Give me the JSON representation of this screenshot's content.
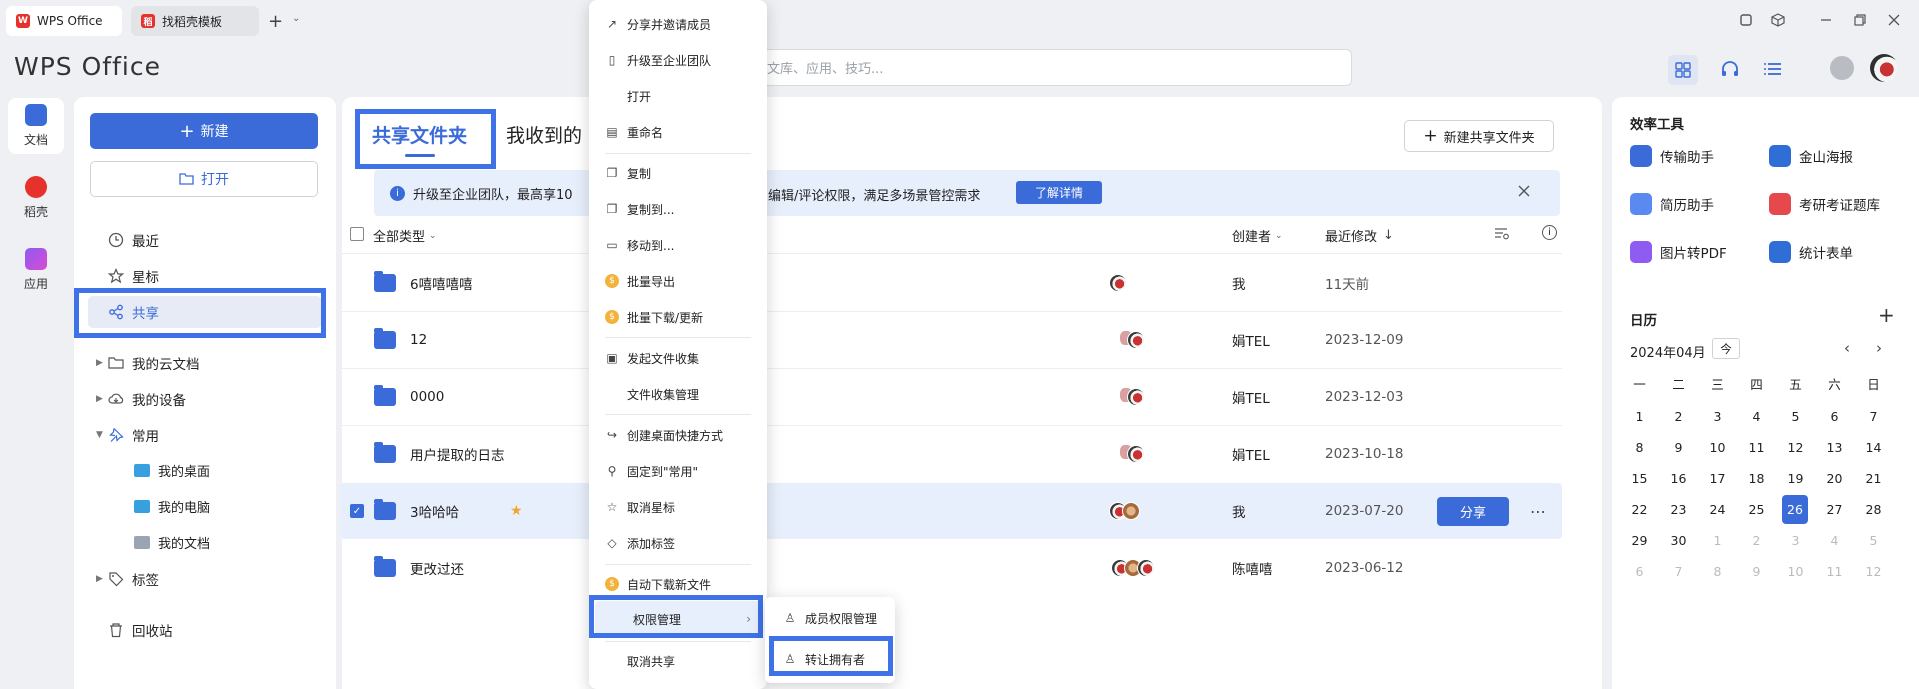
{
  "tabs": [
    {
      "label": "WPS Office",
      "icon": "wps-logo-icon"
    },
    {
      "label": "找稻壳模板",
      "icon": "docer-icon"
    }
  ],
  "app_logo": "WPS Office",
  "search": {
    "placeholder": "文库、应用、技巧..."
  },
  "rail": [
    {
      "label": "文档",
      "icon": "document-icon"
    },
    {
      "label": "稻壳",
      "icon": "docer-icon"
    },
    {
      "label": "应用",
      "icon": "apps-icon"
    }
  ],
  "nav": {
    "new_label": "新建",
    "open_label": "打开",
    "items": [
      "最近",
      "星标",
      "共享",
      "我的云文档",
      "我的设备",
      "常用",
      "标签",
      "回收站"
    ],
    "sub_items": [
      "我的桌面",
      "我的电脑",
      "我的文档"
    ]
  },
  "main": {
    "tab_shared": "共享文件夹",
    "tab_received": "我收到的",
    "new_shared_label": "新建共享文件夹",
    "banner_prefix": "升级至企业团队，最高享10",
    "banner_suffix": "编辑/评论权限，满足多场景管控需求",
    "banner_link": "了解详情",
    "col_type": "全部类型",
    "col_creator": "创建者",
    "col_modified": "最近修改",
    "rows": [
      {
        "name": "6嘻嘻嘻嘻",
        "creator": "我",
        "modified": "11天前"
      },
      {
        "name": "12",
        "creator": "娟TEL",
        "modified": "2023-12-09"
      },
      {
        "name": "0000",
        "creator": "娟TEL",
        "modified": "2023-12-03"
      },
      {
        "name": "用户提取的日志",
        "creator": "娟TEL",
        "modified": "2023-10-18"
      },
      {
        "name": "3哈哈哈",
        "creator": "我",
        "modified": "2023-07-20"
      },
      {
        "name": "更改过还",
        "creator": "陈嘻嘻",
        "modified": "2023-06-12"
      }
    ],
    "share_button": "分享"
  },
  "context_menu": {
    "items": [
      "分享并邀请成员",
      "升级至企业团队",
      "打开",
      "重命名",
      "复制",
      "复制到...",
      "移动到...",
      "批量导出",
      "批量下载/更新",
      "发起文件收集",
      "文件收集管理",
      "创建桌面快捷方式",
      "固定到\"常用\"",
      "取消星标",
      "添加标签",
      "自动下载新文件",
      "权限管理",
      "取消共享"
    ],
    "submenu": [
      "成员权限管理",
      "转让拥有者"
    ]
  },
  "right": {
    "tools_title": "效率工具",
    "tools": [
      "传输助手",
      "金山海报",
      "简历助手",
      "考研考证题库",
      "图片转PDF",
      "统计表单"
    ],
    "calendar_title": "日历",
    "month": "2024年04月",
    "today_label": "今",
    "weekdays": [
      "一",
      "二",
      "三",
      "四",
      "五",
      "六",
      "日"
    ],
    "today": 26
  },
  "colors": {
    "accent": "#3a6bd8",
    "highlight": "#3f72e6"
  }
}
